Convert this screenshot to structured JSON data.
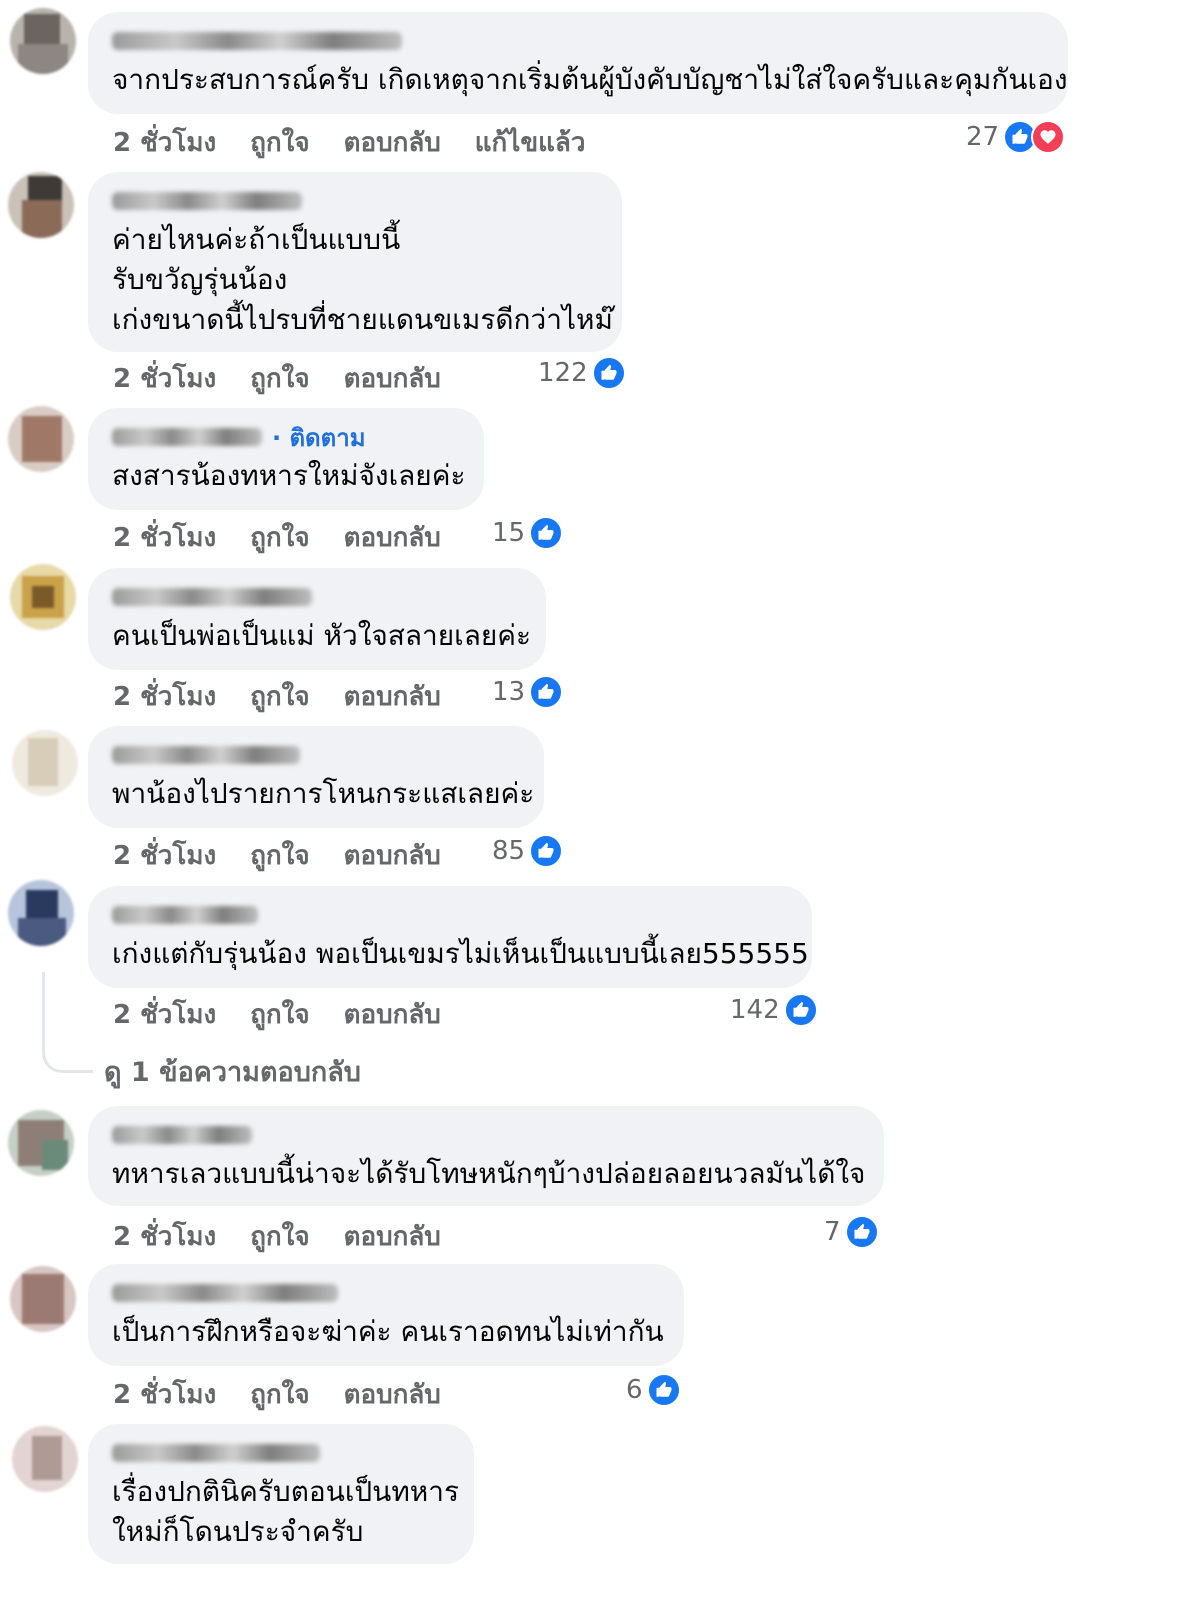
{
  "comments": [
    {
      "text": [
        "จากประสบการณ์ครับ เกิดเหตุจากเริ่มต้นผู้บังคับบัญชาไม่ใส่ใจครับและคุมกันเอง"
      ],
      "time": "2 ชั่วโมง",
      "like": "ถูกใจ",
      "reply": "ตอบกลับ",
      "edited": "แก้ไขแล้ว",
      "count": "27",
      "reactions": [
        "like-icon",
        "love-icon"
      ]
    },
    {
      "text": [
        "ค่ายไหนค่ะถ้าเป็นแบบนี้",
        "รับขวัญรุ่นน้อง",
        "เก่งขนาดนี้ไปรบที่ชายแดนขเมรดีกว่าไหม๊"
      ],
      "time": "2 ชั่วโมง",
      "like": "ถูกใจ",
      "reply": "ตอบกลับ",
      "count": "122",
      "reactions": [
        "like-icon"
      ]
    },
    {
      "text": [
        "สงสารน้องทหารใหม่จังเลยค่ะ"
      ],
      "follow": "· ติดตาม",
      "time": "2 ชั่วโมง",
      "like": "ถูกใจ",
      "reply": "ตอบกลับ",
      "count": "15",
      "reactions": [
        "like-icon"
      ]
    },
    {
      "text": [
        "คนเป็นพ่อเป็นแม่ หัวใจสลายเลยค่ะ"
      ],
      "time": "2 ชั่วโมง",
      "like": "ถูกใจ",
      "reply": "ตอบกลับ",
      "count": "13",
      "reactions": [
        "like-icon"
      ]
    },
    {
      "text": [
        "พาน้องไปรายการโหนกระแสเลยค่ะ"
      ],
      "time": "2 ชั่วโมง",
      "like": "ถูกใจ",
      "reply": "ตอบกลับ",
      "count": "85",
      "reactions": [
        "like-icon"
      ]
    },
    {
      "text": [
        "เก่งแต่กับรุ่นน้อง พอเป็นเขมรไม่เห็นเป็นแบบนี้เลย555555"
      ],
      "time": "2 ชั่วโมง",
      "like": "ถูกใจ",
      "reply": "ตอบกลับ",
      "count": "142",
      "reactions": [
        "like-icon"
      ],
      "view_replies": "ดู 1 ข้อความตอบกลับ"
    },
    {
      "text": [
        "ทหารเลวแบบนี้น่าจะได้รับโทษหนักๆบ้างปล่อยลอยนวลมันได้ใจ"
      ],
      "time": "2 ชั่วโมง",
      "like": "ถูกใจ",
      "reply": "ตอบกลับ",
      "count": "7",
      "reactions": [
        "like-icon"
      ]
    },
    {
      "text": [
        "เป็นการฝึกหรือจะฆ่าค่ะ คนเราอดทนไม่เท่ากัน"
      ],
      "time": "2 ชั่วโมง",
      "like": "ถูกใจ",
      "reply": "ตอบกลับ",
      "count": "6",
      "reactions": [
        "like-icon"
      ]
    },
    {
      "text": [
        "เรื่องปกตินิครับตอนเป็นทหาร",
        "ใหม่ก็โดนประจำครับ"
      ]
    }
  ],
  "colors": {
    "like": "#1877f2",
    "love": "#f33e58",
    "bubble": "#f0f2f5",
    "meta": "#65676b",
    "follow": "#216fdb"
  }
}
